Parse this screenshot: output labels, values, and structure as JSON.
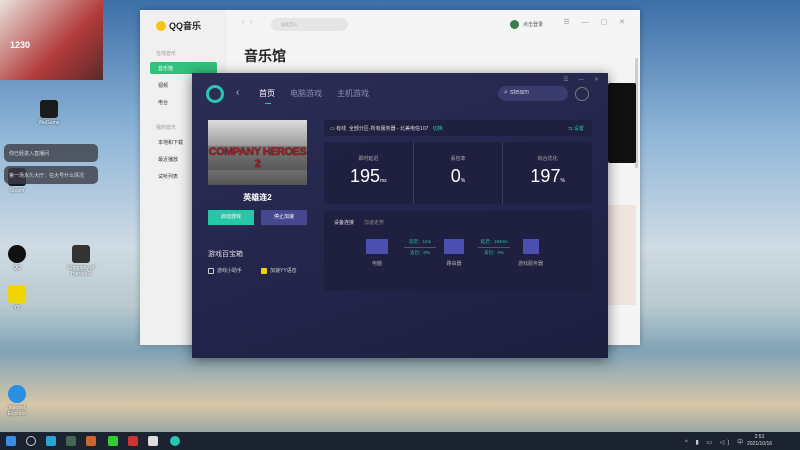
{
  "webcam": {
    "overlay_number": "1230"
  },
  "desktop": {
    "icons": [
      "Steam",
      "Company of Heroes 2",
      "Internet Explorer",
      "QQ",
      "WeGame",
      "YY"
    ],
    "notifications": [
      "你已经进入直播间",
      "第一场永久大厅：在大号什么情况"
    ]
  },
  "qqmusic": {
    "app_name": "QQ音乐",
    "search_placeholder": "搜索音乐",
    "section_online": "在线音乐",
    "section_mine": "我的音乐",
    "nav": [
      {
        "label": "音乐馆",
        "active": true
      },
      {
        "label": "视频"
      },
      {
        "label": "电台"
      },
      {
        "label": "本地和下载"
      },
      {
        "label": "最近播放"
      },
      {
        "label": "试听列表"
      }
    ],
    "page_title": "音乐馆",
    "login": "点击登录"
  },
  "accelerator": {
    "tabs": [
      {
        "label": "首页",
        "active": true
      },
      {
        "label": "电脑游戏"
      },
      {
        "label": "主机游戏"
      }
    ],
    "search_value": "steam",
    "game": {
      "cover_text": "COMPANY HEROES 2",
      "name": "英雄连2"
    },
    "start_button": "启动游戏",
    "stop_button": "停止加速",
    "toolbox_title": "游戏百宝箱",
    "tools": [
      "游戏小助手",
      "加速YY语音"
    ],
    "connection": {
      "type": "有线",
      "region": "全部分区-所有服务器 - 北美电信107",
      "switch": "切换",
      "settings": "设置"
    },
    "stats": [
      {
        "label": "即时延迟",
        "value": "195",
        "unit": "ms"
      },
      {
        "label": "丢包率",
        "value": "0",
        "unit": "%"
      },
      {
        "label": "综合优化",
        "value": "197",
        "unit": "%"
      }
    ],
    "panel_tabs": [
      "设备连接",
      "加速走势"
    ],
    "devices": [
      "电脑",
      "路由器",
      "游戏服务器"
    ],
    "links": [
      {
        "latency": "延迟：1ms",
        "loss": "丢包：0%"
      },
      {
        "latency": "延迟：194ms",
        "loss": "丢包：0%"
      }
    ]
  },
  "taskbar": {
    "time": "2:51",
    "date": "2021/10/16",
    "ime": "中"
  }
}
